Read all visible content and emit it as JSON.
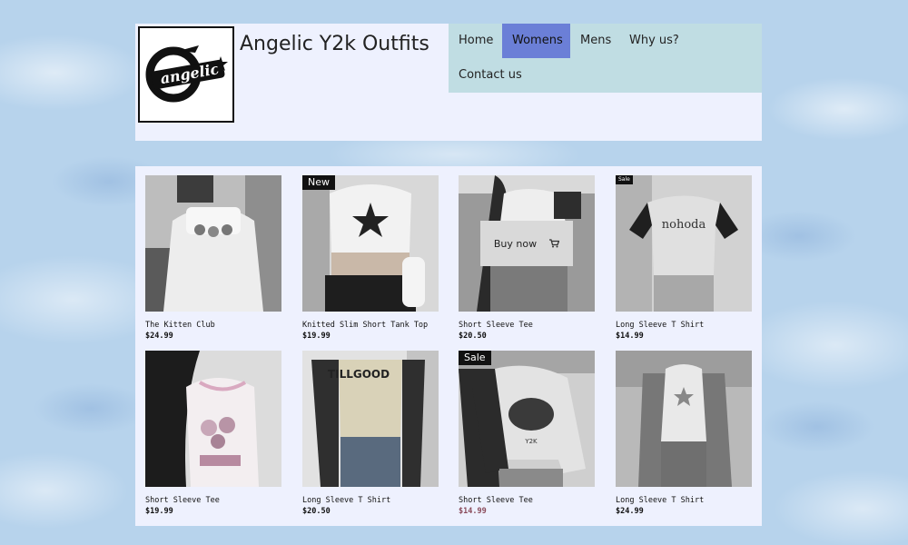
{
  "site": {
    "title": "Angelic Y2k Outfits",
    "logo_text": "angelic"
  },
  "nav": {
    "items": [
      {
        "label": "Home",
        "active": false
      },
      {
        "label": "Womens",
        "active": true
      },
      {
        "label": "Mens",
        "active": false
      },
      {
        "label": "Why us?",
        "active": false
      },
      {
        "label": "Contact us",
        "active": false
      }
    ]
  },
  "products": [
    {
      "name": "The Kitten Club",
      "price": "$24.99",
      "badge": ""
    },
    {
      "name": "Knitted Slim Short Tank Top",
      "price": "$19.99",
      "badge": "New"
    },
    {
      "name": "Short Sleeve Tee",
      "price": "$20.50",
      "badge": "",
      "buy_label": "Buy now"
    },
    {
      "name": "Long Sleeve T Shirt",
      "price": "$14.99",
      "badge": "Sale"
    },
    {
      "name": "Short Sleeve Tee",
      "price": "$19.99",
      "badge": ""
    },
    {
      "name": "Long Sleeve T Shirt",
      "price": "$20.50",
      "badge": ""
    },
    {
      "name": "Short Sleeve Tee",
      "price": "$14.99",
      "badge": "Sale"
    },
    {
      "name": "Long Sleeve T Shirt",
      "price": "$24.99",
      "badge": ""
    }
  ],
  "colors": {
    "nav_bg": "#c0dde3",
    "nav_active": "#6b7fd7",
    "panel_bg": "#eef1fe",
    "sale_price": "#8a4a5a"
  }
}
